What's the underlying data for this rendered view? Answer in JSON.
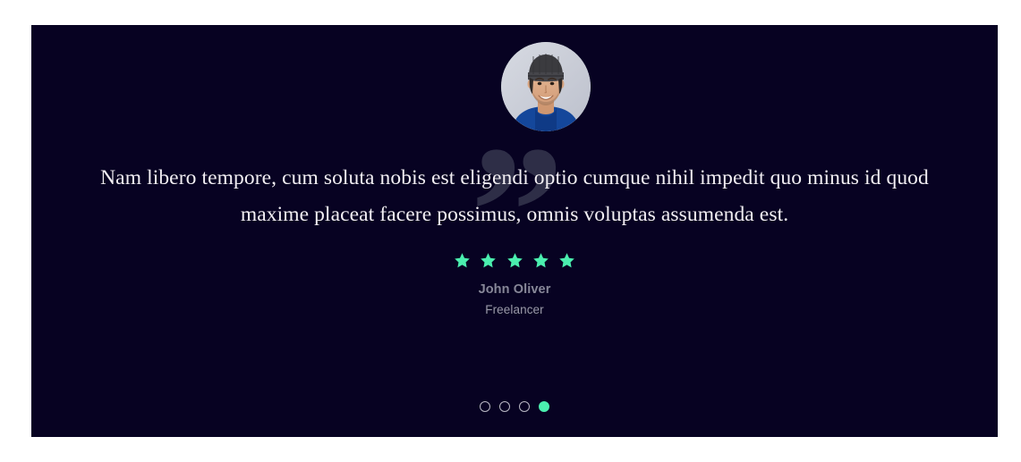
{
  "panel": {
    "background_color": "#070222"
  },
  "testimonial": {
    "avatar": {
      "icon": "avatar-photo",
      "alt": "Smiling young man wearing a dark beanie and blue shirt"
    },
    "decorative_quote_glyph": "”",
    "quote": "Nam libero tempore, cum soluta nobis est eligendi optio cumque nihil impedit quo minus id quod maxime placeat facere possimus, omnis voluptas assumenda est.",
    "rating": {
      "value": 5,
      "max": 5,
      "icon": "star-icon",
      "color": "#4befaf"
    },
    "author_name": "John Oliver",
    "author_role": "Freelancer"
  },
  "pagination": {
    "count": 4,
    "active_index": 3,
    "active_color": "#4befaf",
    "inactive_border_color": "#b9b8c4"
  },
  "colors": {
    "accent": "#4befaf",
    "panel_bg": "#070222",
    "quote_text": "#f2eff3",
    "quote_glyph": "#2e2e47",
    "author_name": "#878798",
    "author_role": "#9a9aa8"
  }
}
